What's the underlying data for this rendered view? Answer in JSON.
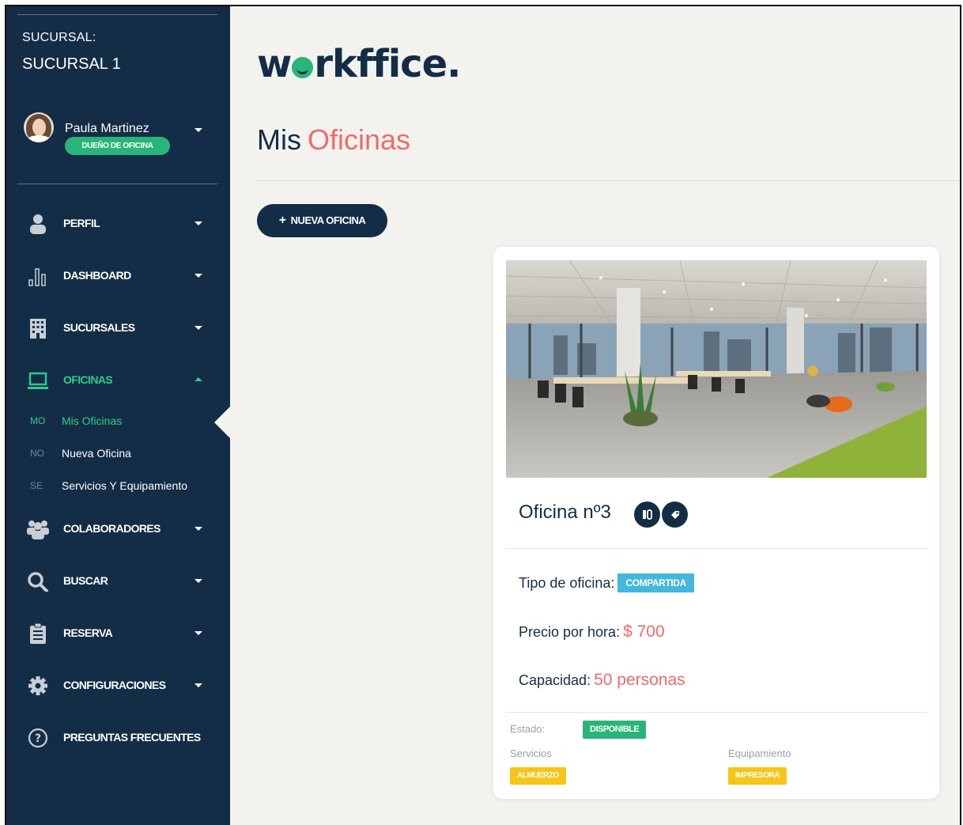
{
  "sidebar": {
    "branch_label": "SUCURSAL:",
    "branch_name": "SUCURSAL 1",
    "user": {
      "name": "Paula Martinez",
      "role": "DUEÑO DE OFICINA"
    },
    "nav": [
      {
        "label": "PERFIL",
        "icon": "user-icon"
      },
      {
        "label": "DASHBOARD",
        "icon": "bar-chart-icon"
      },
      {
        "label": "SUCURSALES",
        "icon": "building-icon"
      },
      {
        "label": "OFICINAS",
        "icon": "laptop-icon",
        "active": true
      },
      {
        "label": "COLABORADORES",
        "icon": "users-icon"
      },
      {
        "label": "BUSCAR",
        "icon": "search-icon"
      },
      {
        "label": "RESERVA",
        "icon": "clipboard-icon"
      },
      {
        "label": "CONFIGURACIONES",
        "icon": "gear-icon"
      },
      {
        "label": "PREGUNTAS FRECUENTES",
        "icon": "question-icon"
      }
    ],
    "subnav": [
      {
        "abbr": "MO",
        "label": "Mis Oficinas",
        "active": true
      },
      {
        "abbr": "NO",
        "label": "Nueva Oficina"
      },
      {
        "abbr": "SE",
        "label": "Servicios Y Equipamiento"
      }
    ]
  },
  "main": {
    "logo_parts": [
      "w",
      "rkffice."
    ],
    "title": "Mis",
    "title_accent": "Oficinas",
    "new_button": "NUEVA OFICINA",
    "card": {
      "title": "Oficina nº3",
      "type_label": "Tipo de oficina:",
      "type_value": "COMPARTIDA",
      "price_label": "Precio por hora:",
      "price_value": "$ 700",
      "capacity_label": "Capacidad:",
      "capacity_value": "50 personas",
      "state_label": "Estado:",
      "state_value": "DISPONIBLE",
      "services_label": "Servicios",
      "services_value": "ALMUERZO",
      "equipment_label": "Equipamiento",
      "equipment_value": "IMPRESORA"
    }
  },
  "colors": {
    "sidebar_bg": "#142d47",
    "accent_green": "#29b57a",
    "accent_red": "#ef6b6b",
    "tag_blue": "#45b6dc",
    "tag_yellow": "#f5c518"
  }
}
